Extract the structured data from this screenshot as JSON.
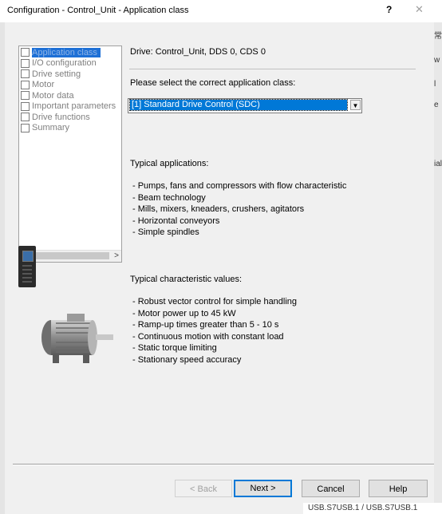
{
  "window": {
    "title": "Configuration - Control_Unit - Application class",
    "help_label": "?",
    "close_label": "✕"
  },
  "background": {
    "right_chars": [
      "常",
      "w",
      "l",
      "e",
      "ial"
    ],
    "footer_text": "USB.S7USB.1 / USB.S7USB.1"
  },
  "tree": {
    "items": [
      {
        "label": "Application class",
        "selected": true
      },
      {
        "label": "I/O configuration"
      },
      {
        "label": "Drive setting"
      },
      {
        "label": "Motor"
      },
      {
        "label": "Motor data"
      },
      {
        "label": "Important parameters"
      },
      {
        "label": "Drive functions"
      },
      {
        "label": "Summary"
      }
    ],
    "scroll_left": "<",
    "scroll_right": ">"
  },
  "main": {
    "drive_label": "Drive: Control_Unit, DDS 0, CDS 0",
    "select_prompt": "Please select the correct application class:",
    "application_class": {
      "selected": "[1] Standard Drive Control (SDC)"
    },
    "typical_applications_heading": "Typical applications:",
    "typical_applications": [
      "- Pumps, fans and compressors with flow characteristic",
      "- Beam technology",
      "- Mills, mixers, kneaders, crushers, agitators",
      "- Horizontal conveyors",
      "- Simple spindles"
    ],
    "typical_values_heading": "Typical characteristic values:",
    "typical_values": [
      "- Robust vector control for simple handling",
      "- Motor power up to 45 kW",
      "- Ramp-up times greater than 5 - 10 s",
      "-  Continuous motion with constant load",
      "- Static torque limiting",
      "- Stationary speed accuracy"
    ]
  },
  "footer": {
    "back_label": "< Back",
    "next_label": "Next >",
    "cancel_label": "Cancel",
    "help_label": "Help"
  }
}
